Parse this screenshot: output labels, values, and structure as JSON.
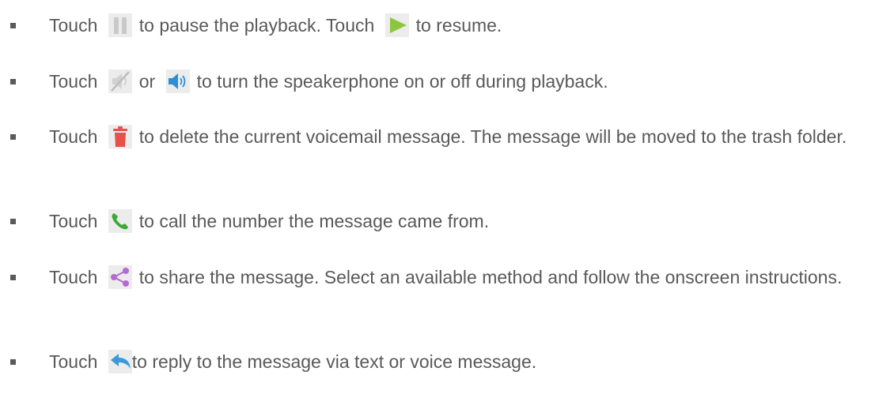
{
  "items": [
    {
      "t1": "Touch",
      "t2": "to pause the playback. Touch",
      "t3": "to resume."
    },
    {
      "t1": "Touch",
      "t2": "or",
      "t3": "to turn the speakerphone on or off during playback."
    },
    {
      "t1": "Touch",
      "t2": "to delete the current voicemail message. The message will be moved to the trash folder."
    },
    {
      "t1": "Touch",
      "t2": "to call the number the message came from."
    },
    {
      "t1": "Touch",
      "t2": "to share the message. Select an available method and follow the onscreen instructions."
    },
    {
      "t1": "Touch",
      "t2": "to reply to the message via text or voice message."
    }
  ],
  "icons": {
    "pause": "pause-icon",
    "play": "play-icon",
    "speaker_off": "speaker-off-icon",
    "speaker_on": "speaker-on-icon",
    "delete": "trash-icon",
    "call": "phone-icon",
    "share": "share-icon",
    "reply": "reply-icon"
  },
  "colors": {
    "text": "#595959",
    "play": "#8cc63f",
    "speaker_on": "#2a8fd8",
    "delete": "#e8504a",
    "call": "#3aaa35",
    "share": "#b36ad1",
    "reply": "#3a9ad9"
  }
}
